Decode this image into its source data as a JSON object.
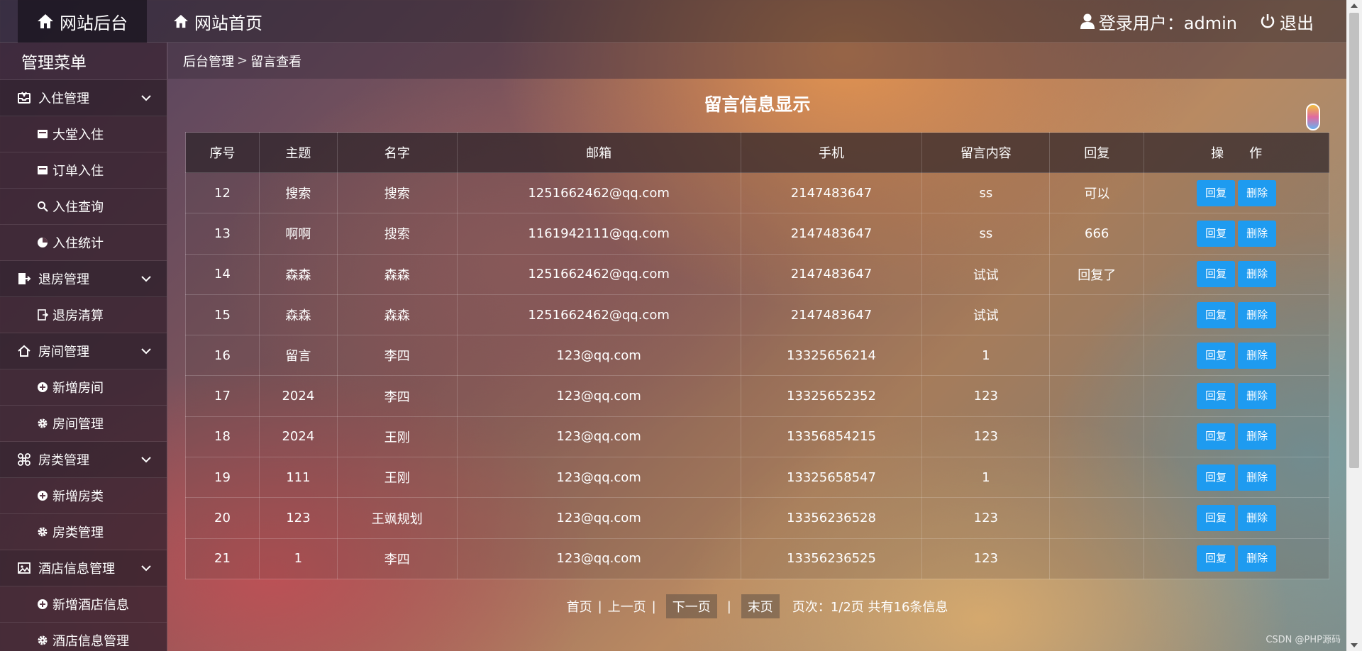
{
  "topbar": {
    "brand": "网站后台",
    "home": "网站首页",
    "user_label": "登录用户：admin",
    "logout": "退出"
  },
  "sidebar": {
    "title": "管理菜单",
    "groups": [
      {
        "label": "入住管理",
        "icon": "inbox-icon",
        "items": [
          {
            "label": "大堂入住",
            "icon": "card-icon"
          },
          {
            "label": "订单入住",
            "icon": "card-icon"
          },
          {
            "label": "入住查询",
            "icon": "search-icon"
          },
          {
            "label": "入住统计",
            "icon": "pie-chart-icon"
          }
        ]
      },
      {
        "label": "退房管理",
        "icon": "sign-out-icon",
        "items": [
          {
            "label": "退房清算",
            "icon": "file-export-icon"
          }
        ]
      },
      {
        "label": "房间管理",
        "icon": "house-icon",
        "items": [
          {
            "label": "新增房间",
            "icon": "plus-circle-icon"
          },
          {
            "label": "房间管理",
            "icon": "gear-icon"
          }
        ]
      },
      {
        "label": "房类管理",
        "icon": "command-icon",
        "items": [
          {
            "label": "新增房类",
            "icon": "plus-circle-icon"
          },
          {
            "label": "房类管理",
            "icon": "gear-icon"
          }
        ]
      },
      {
        "label": "酒店信息管理",
        "icon": "image-icon",
        "items": [
          {
            "label": "新增酒店信息",
            "icon": "plus-circle-icon"
          },
          {
            "label": "酒店信息管理",
            "icon": "gear-icon"
          }
        ]
      }
    ]
  },
  "breadcrumb": {
    "root": "后台管理",
    "sep": ">",
    "current": "留言查看"
  },
  "page_title": "留言信息显示",
  "table": {
    "headers": [
      "序号",
      "主题",
      "名字",
      "邮箱",
      "手机",
      "留言内容",
      "回复",
      "操　　作"
    ],
    "reply_btn": "回复",
    "delete_btn": "删除",
    "rows": [
      [
        "12",
        "搜索",
        "搜索",
        "1251662462@qq.com",
        "2147483647",
        "ss",
        "可以"
      ],
      [
        "13",
        "啊啊",
        "搜索",
        "1161942111@qq.com",
        "2147483647",
        "ss",
        "666"
      ],
      [
        "14",
        "森森",
        "森森",
        "1251662462@qq.com",
        "2147483647",
        "试试",
        "回复了"
      ],
      [
        "15",
        "森森",
        "森森",
        "1251662462@qq.com",
        "2147483647",
        "试试",
        ""
      ],
      [
        "16",
        "留言",
        "李四",
        "123@qq.com",
        "13325656214",
        "1",
        ""
      ],
      [
        "17",
        "2024",
        "李四",
        "123@qq.com",
        "13325652352",
        "123",
        ""
      ],
      [
        "18",
        "2024",
        "王刚",
        "123@qq.com",
        "13356854215",
        "123",
        ""
      ],
      [
        "19",
        "111",
        "王刚",
        "123@qq.com",
        "13325658547",
        "1",
        ""
      ],
      [
        "20",
        "123",
        "王飒规划",
        "123@qq.com",
        "13356236528",
        "123",
        ""
      ],
      [
        "21",
        "1",
        "李四",
        "123@qq.com",
        "13356236525",
        "123",
        ""
      ]
    ]
  },
  "pager": {
    "first": "首页",
    "sep": "|",
    "prev": "上一页",
    "next": "下一页",
    "last": "末页",
    "info": "页次：1/2页 共有16条信息"
  },
  "watermark": "CSDN @PHP源码"
}
